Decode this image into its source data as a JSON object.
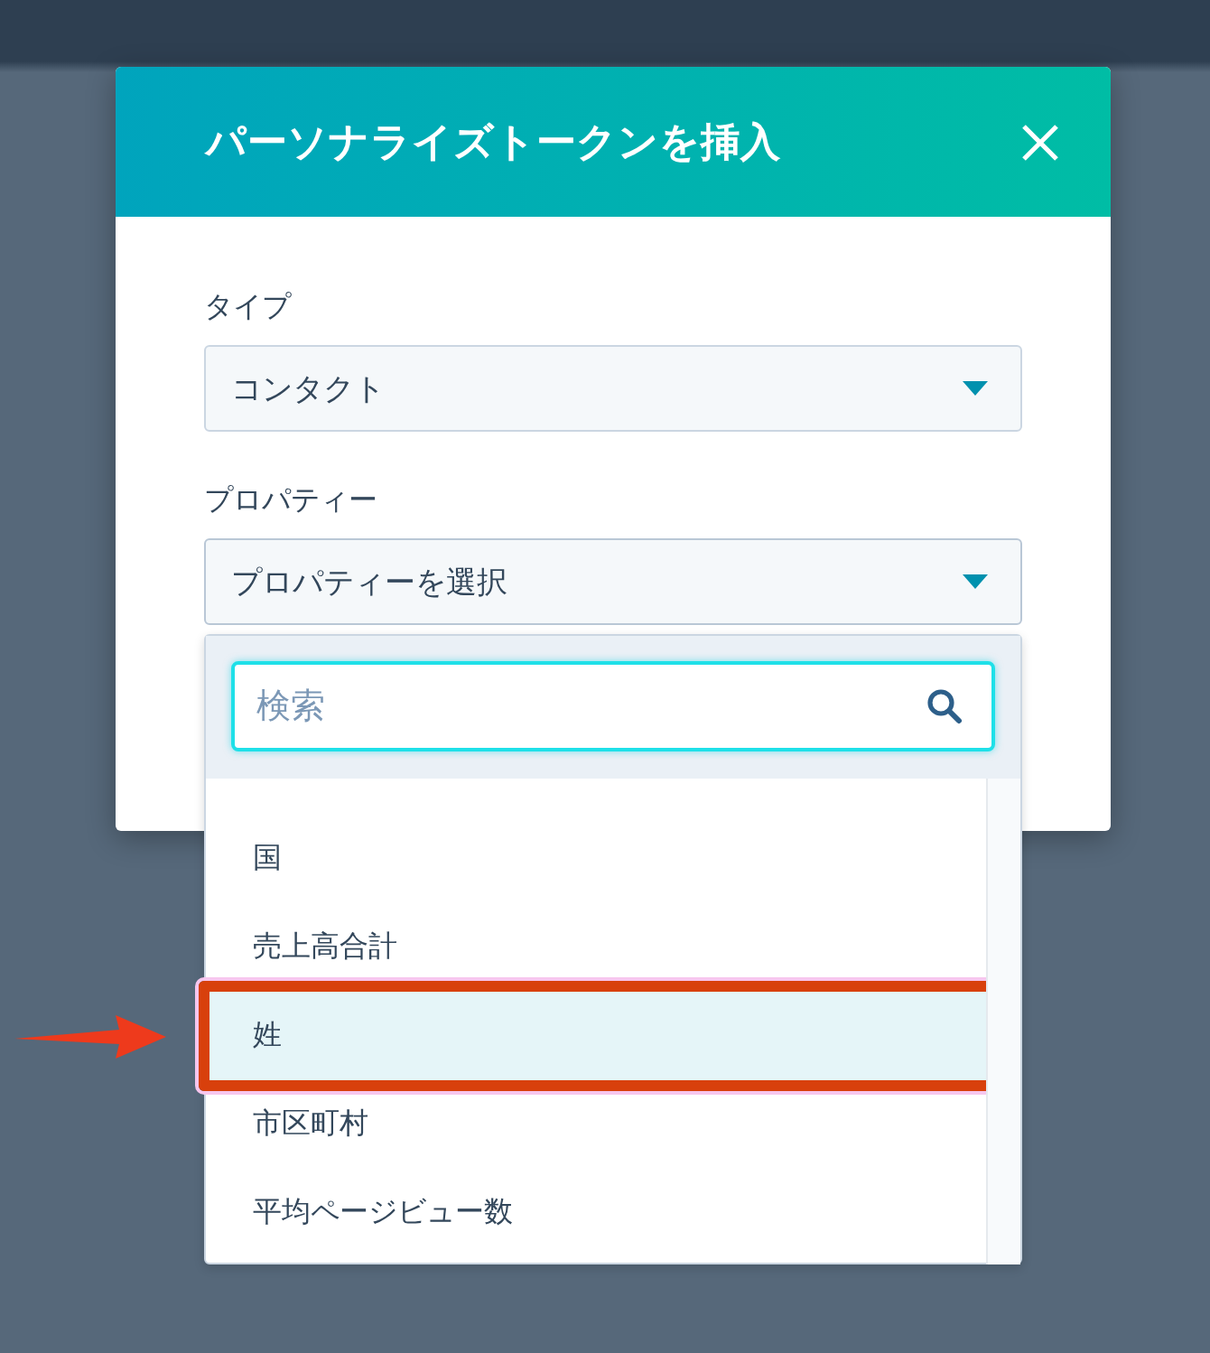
{
  "dialog": {
    "title": "パーソナライズトークンを挿入"
  },
  "fields": [
    {
      "label": "タイプ",
      "value": "コンタクト",
      "expanded": false
    },
    {
      "label": "プロパティー",
      "value": "プロパティーを選択",
      "expanded": true
    }
  ],
  "dropdown": {
    "search": {
      "placeholder": "検索"
    },
    "items": [
      {
        "label": "国",
        "selected": false,
        "annotated": false
      },
      {
        "label": "売上高合計",
        "selected": false,
        "annotated": false
      },
      {
        "label": "姓",
        "selected": true,
        "annotated": true
      },
      {
        "label": "市区町村",
        "selected": false,
        "annotated": false
      },
      {
        "label": "平均ページビュー数",
        "selected": false,
        "annotated": false
      }
    ]
  }
}
